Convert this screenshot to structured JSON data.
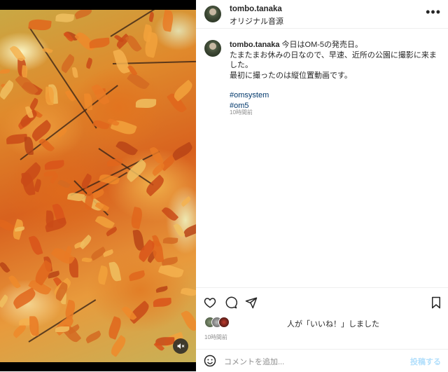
{
  "post": {
    "username": "tombo.tanaka",
    "audio_label": "オリジナル音源",
    "caption_lines": [
      "今日はOM-5の発売日。",
      "たまたまお休みの日なので、早速、近所の公園に撮影に来ました。",
      "最初に撮ったのは縦位置動画です。"
    ],
    "hashtags": [
      "#omsystem",
      "#om5"
    ],
    "caption_time": "10時間前",
    "likes_text": "人が「いいね！」しました",
    "post_time": "10時間前"
  },
  "comment": {
    "placeholder": "コメントを追加...",
    "post_label": "投稿する"
  },
  "icons": {
    "more": "more-options-icon",
    "like": "heart-icon",
    "comment": "comment-bubble-icon",
    "share": "paper-plane-icon",
    "save": "bookmark-icon",
    "emoji": "emoji-smile-icon",
    "mute": "speaker-muted-icon"
  },
  "colors": {
    "hashtag": "#00376b",
    "post_button_disabled": "#b2dffc",
    "secondary_text": "#8e8e8e"
  }
}
